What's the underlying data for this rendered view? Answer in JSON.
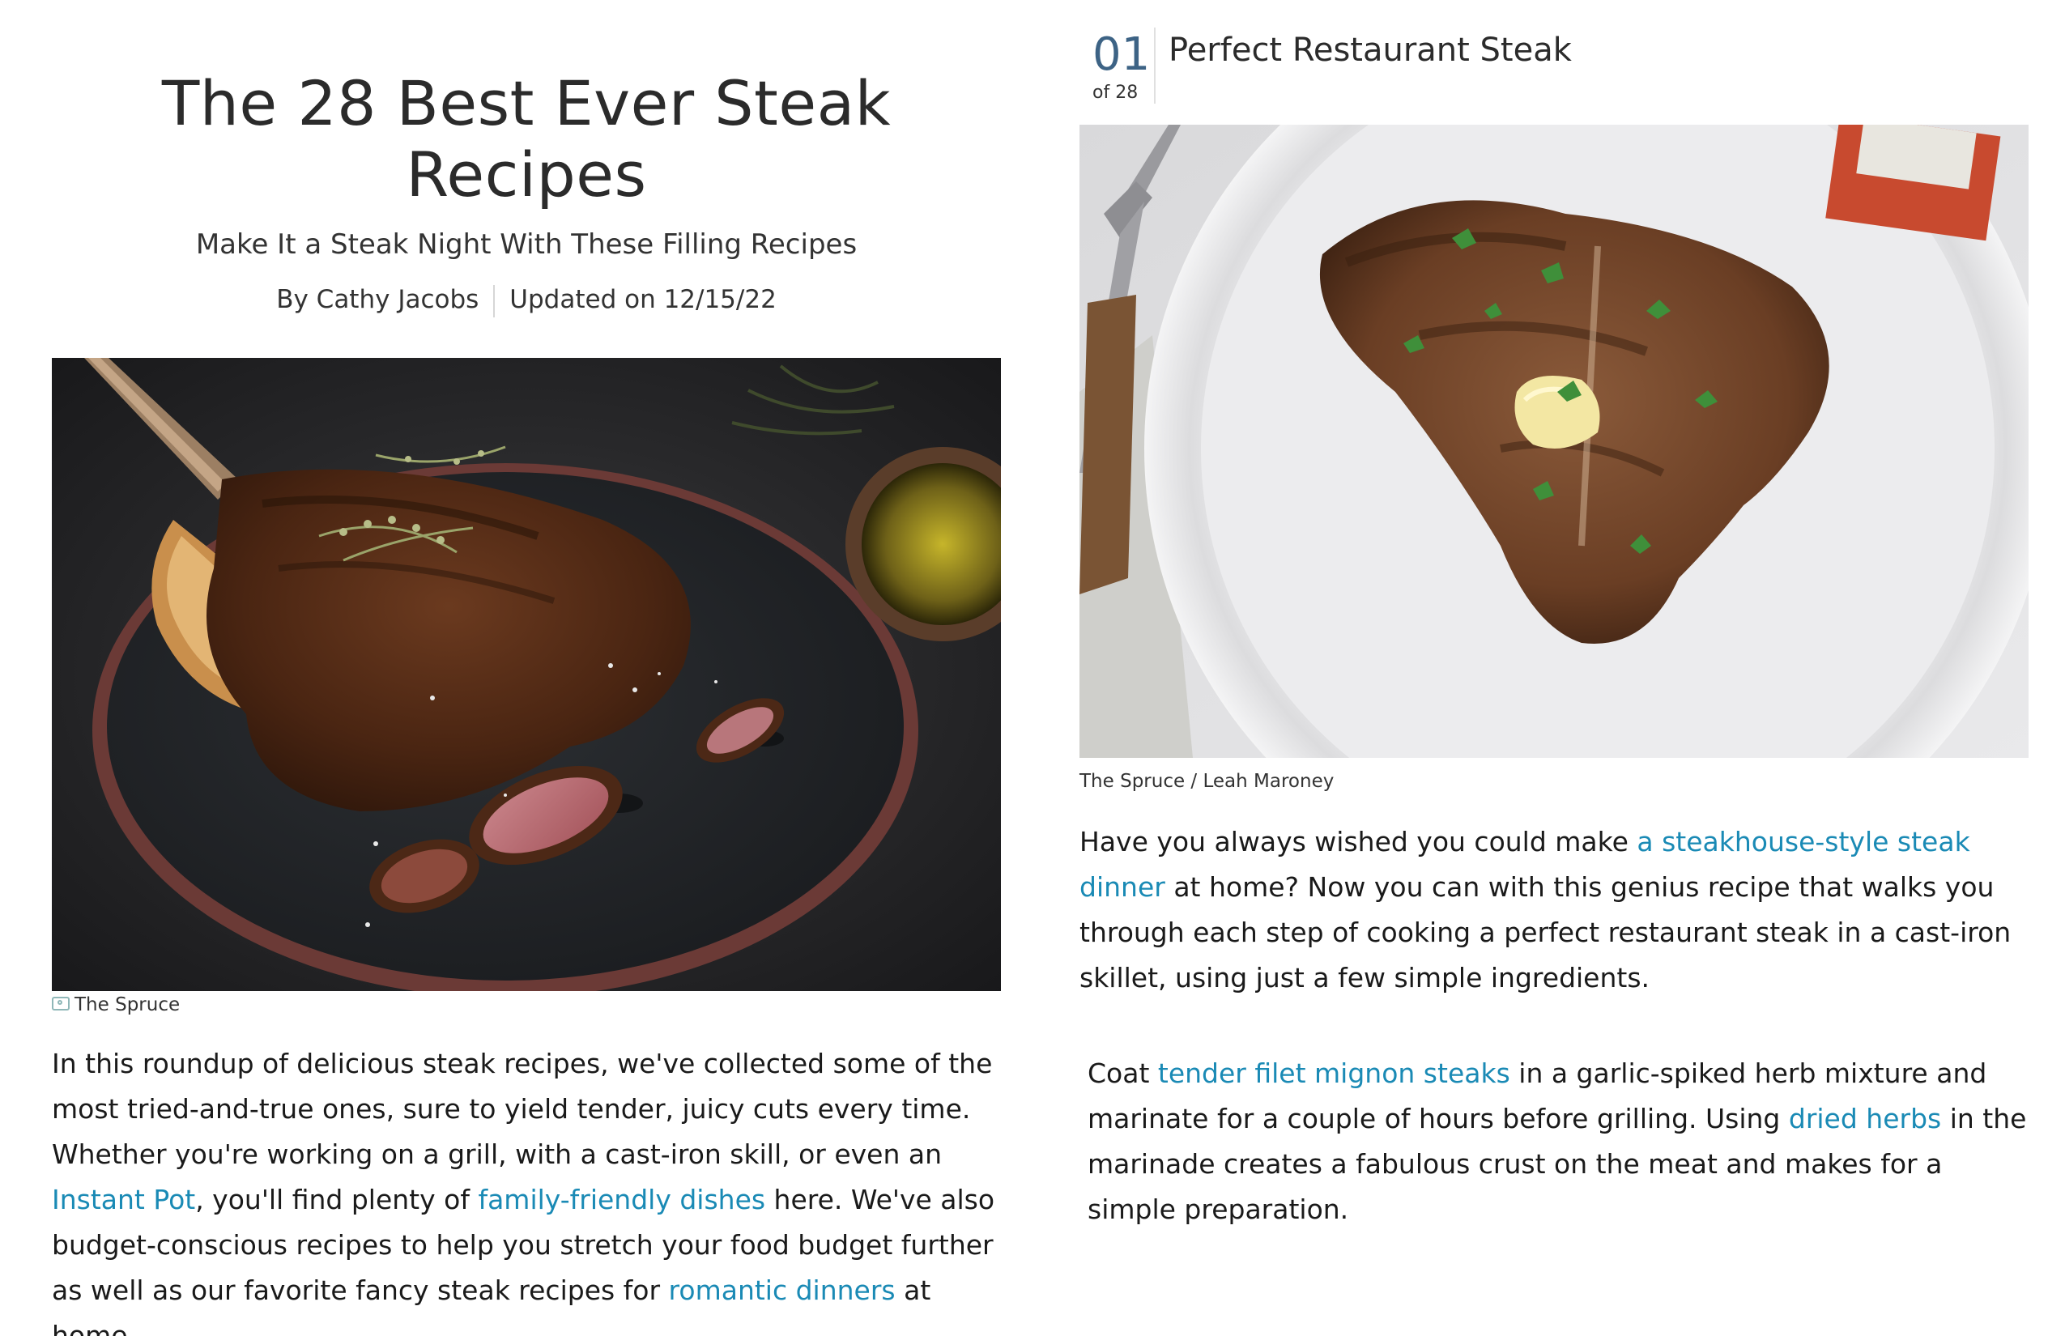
{
  "article": {
    "title": "The 28 Best Ever Steak Recipes",
    "subtitle": "Make It a Steak Night With These Filling Recipes",
    "author": "By Cathy Jacobs",
    "updated": "Updated on 12/15/22"
  },
  "hero": {
    "caption": "The Spruce",
    "icon": "camera-icon"
  },
  "intro": {
    "p1": "In this roundup of delicious steak recipes, we've collected some of the most tried-and-true ones, sure to yield tender, juicy cuts every time. Whether you're working on a grill, with a cast-iron skill, or even an ",
    "link1": "Instant Pot",
    "p2": ", you'll find plenty of ",
    "link2": "family-friendly dishes",
    "p3": " here. We've also budget-conscious recipes to help you stretch your food budget further as well as our favorite fancy steak recipes for ",
    "link3": "romantic dinners",
    "p4": " at home."
  },
  "item": {
    "number": "01",
    "of": "of 28",
    "title": "Perfect Restaurant Steak",
    "caption": "The Spruce / Leah Maroney",
    "para1": {
      "t1": "Have you always wished you could make ",
      "link": "a steakhouse-style steak dinner",
      "t2": " at home? Now you can with this genius recipe that walks you through each step of cooking a perfect restaurant steak in a cast-iron skillet, using just a few simple ingredients."
    },
    "para2": {
      "t1": "Coat ",
      "link1": "tender filet mignon steaks",
      "t2": " in a garlic-spiked herb mixture and marinate for a couple of hours before grilling. Using ",
      "link2": "dried herbs",
      "t3": " in the marinade creates a fabulous crust on the meat and makes for a simple preparation."
    }
  },
  "colors": {
    "link": "#1a8ab5",
    "number": "#3d6385",
    "text": "#1a1a1a"
  }
}
